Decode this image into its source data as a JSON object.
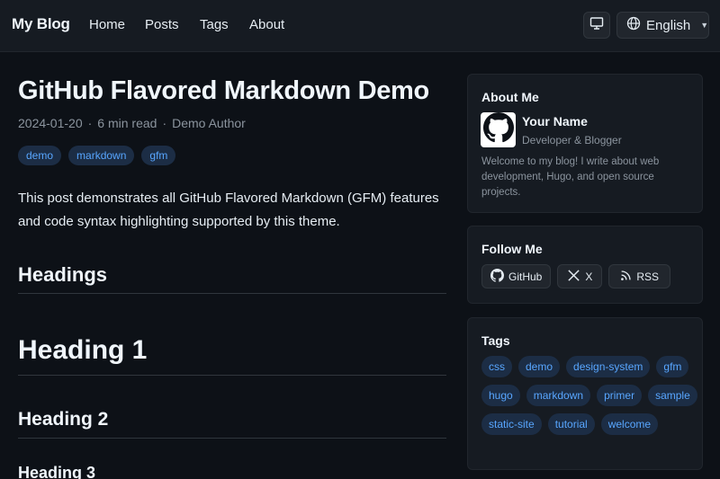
{
  "header": {
    "brand": "My Blog",
    "nav": [
      "Home",
      "Posts",
      "Tags",
      "About"
    ],
    "theme_icon": "monitor-icon",
    "language": "English"
  },
  "post": {
    "title": "GitHub Flavored Markdown Demo",
    "date": "2024-01-20",
    "read_time": "6 min read",
    "author": "Demo Author",
    "tags": [
      "demo",
      "markdown",
      "gfm"
    ],
    "intro": "This post demonstrates all GitHub Flavored Markdown (GFM) features and code syntax highlighting supported by this theme.",
    "headings": {
      "section": "Headings",
      "h1": "Heading 1",
      "h2": "Heading 2",
      "h3": "Heading 3"
    }
  },
  "sidebar": {
    "about": {
      "title": "About Me",
      "name": "Your Name",
      "role": "Developer & Blogger",
      "bio": "Welcome to my blog! I write about web development, Hugo, and open source projects."
    },
    "follow": {
      "title": "Follow Me",
      "links": [
        {
          "label": "GitHub",
          "icon": "github-icon"
        },
        {
          "label": "X",
          "icon": "x-icon"
        },
        {
          "label": "RSS",
          "icon": "rss-icon"
        }
      ]
    },
    "tags": {
      "title": "Tags",
      "items": [
        "css",
        "demo",
        "design-system",
        "gfm",
        "hugo",
        "markdown",
        "primer",
        "sample",
        "static-site",
        "tutorial",
        "welcome"
      ]
    }
  },
  "colors": {
    "background": "#0d1117",
    "surface": "#161b22",
    "accent": "#58a6ff",
    "tag_bg": "#1c2d45",
    "muted": "#8b949e"
  }
}
